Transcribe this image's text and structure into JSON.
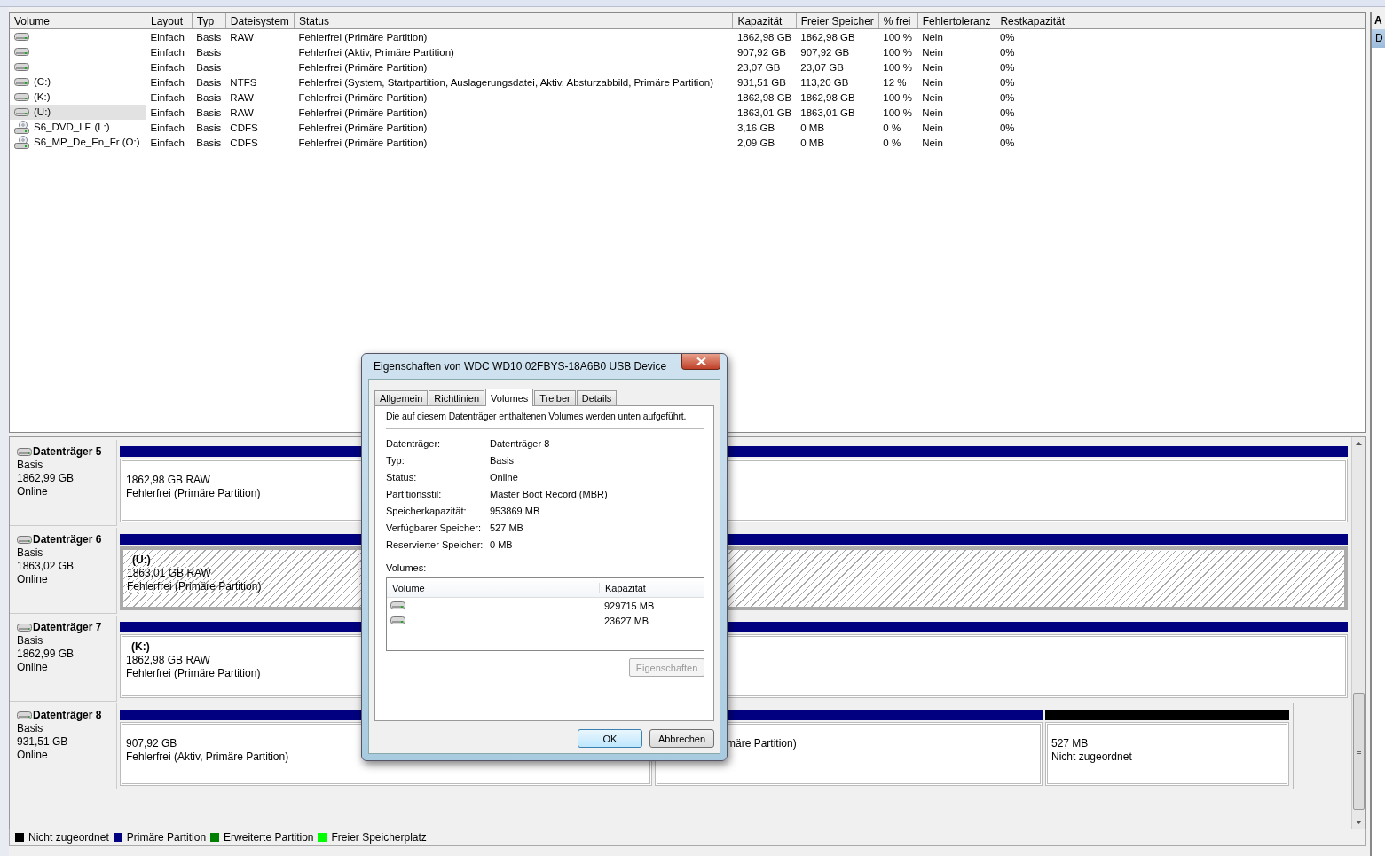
{
  "volumes_table": {
    "columns": [
      "Volume",
      "Layout",
      "Typ",
      "Dateisystem",
      "Status",
      "Kapazität",
      "Freier Speicher",
      "% frei",
      "Fehlertoleranz",
      "Restkapazität"
    ],
    "rows": [
      {
        "kind": "disk",
        "selected": false,
        "layout": "Einfach",
        "type": "Basis",
        "filesystem": "RAW",
        "status": "Fehlerfrei (Primäre Partition)",
        "capacity": "1862,98 GB",
        "free": "1862,98 GB",
        "percent_free": "100 %",
        "fault_tolerance": "Nein",
        "overhead": "0%"
      },
      {
        "kind": "disk",
        "selected": false,
        "layout": "Einfach",
        "type": "Basis",
        "status": "Fehlerfrei (Aktiv, Primäre Partition)",
        "capacity": "907,92 GB",
        "free": "907,92 GB",
        "percent_free": "100 %",
        "fault_tolerance": "Nein",
        "overhead": "0%"
      },
      {
        "kind": "disk",
        "selected": false,
        "layout": "Einfach",
        "type": "Basis",
        "status": "Fehlerfrei (Primäre Partition)",
        "capacity": "23,07 GB",
        "free": "23,07 GB",
        "percent_free": "100 %",
        "fault_tolerance": "Nein",
        "overhead": "0%"
      },
      {
        "kind": "disk",
        "selected": false,
        "volume": "(C:)",
        "layout": "Einfach",
        "type": "Basis",
        "filesystem": "NTFS",
        "status": "Fehlerfrei (System, Startpartition, Auslagerungsdatei, Aktiv, Absturzabbild, Primäre Partition)",
        "capacity": "931,51 GB",
        "free": "113,20 GB",
        "percent_free": "12 %",
        "fault_tolerance": "Nein",
        "overhead": "0%"
      },
      {
        "kind": "disk",
        "selected": false,
        "volume": "(K:)",
        "layout": "Einfach",
        "type": "Basis",
        "filesystem": "RAW",
        "status": "Fehlerfrei (Primäre Partition)",
        "capacity": "1862,98 GB",
        "free": "1862,98 GB",
        "percent_free": "100 %",
        "fault_tolerance": "Nein",
        "overhead": "0%"
      },
      {
        "kind": "disk",
        "selected": true,
        "volume": "(U:)",
        "layout": "Einfach",
        "type": "Basis",
        "filesystem": "RAW",
        "status": "Fehlerfrei (Primäre Partition)",
        "capacity": "1863,01 GB",
        "free": "1863,01 GB",
        "percent_free": "100 %",
        "fault_tolerance": "Nein",
        "overhead": "0%"
      },
      {
        "kind": "optical",
        "selected": false,
        "volume": "S6_DVD_LE (L:)",
        "layout": "Einfach",
        "type": "Basis",
        "filesystem": "CDFS",
        "status": "Fehlerfrei (Primäre Partition)",
        "capacity": "3,16 GB",
        "free": "0 MB",
        "percent_free": "0 %",
        "fault_tolerance": "Nein",
        "overhead": "0%"
      },
      {
        "kind": "optical",
        "selected": false,
        "volume": "S6_MP_De_En_Fr (O:)",
        "layout": "Einfach",
        "type": "Basis",
        "filesystem": "CDFS",
        "status": "Fehlerfrei (Primäre Partition)",
        "capacity": "2,09 GB",
        "free": "0 MB",
        "percent_free": "0 %",
        "fault_tolerance": "Nein",
        "overhead": "0%"
      }
    ]
  },
  "disks": [
    {
      "name": "Datenträger 5",
      "type": "Basis",
      "size": "1862,99 GB",
      "status": "Online",
      "partitions": [
        {
          "kind": "primary",
          "selected": false,
          "size_line": "1862,98 GB RAW",
          "status_line": "Fehlerfrei (Primäre Partition)"
        }
      ]
    },
    {
      "name": "Datenträger 6",
      "type": "Basis",
      "size": "1863,02 GB",
      "status": "Online",
      "partitions": [
        {
          "kind": "primary",
          "selected": true,
          "label": "(U:)",
          "size_line": "1863,01 GB RAW",
          "status_line": "Fehlerfrei (Primäre Partition)"
        }
      ]
    },
    {
      "name": "Datenträger 7",
      "type": "Basis",
      "size": "1862,99 GB",
      "status": "Online",
      "partitions": [
        {
          "kind": "primary",
          "selected": false,
          "label": "(K:)",
          "size_line": "1862,98 GB RAW",
          "status_line": "Fehlerfrei (Primäre Partition)"
        }
      ]
    },
    {
      "name": "Datenträger 8",
      "type": "Basis",
      "size": "931,51 GB",
      "status": "Online",
      "partitions": [
        {
          "kind": "primary",
          "selected": false,
          "size_line": "907,92 GB",
          "status_line": "Fehlerfrei (Aktiv, Primäre Partition)"
        },
        {
          "kind": "primary",
          "selected": false,
          "cut": true,
          "status_line": "märe Partition)"
        },
        {
          "kind": "unallocated",
          "selected": false,
          "size_line": "527 MB",
          "status_line": "Nicht zugeordnet"
        }
      ]
    }
  ],
  "legend": [
    {
      "label": "Nicht zugeordnet",
      "color": "#000000"
    },
    {
      "label": "Primäre Partition",
      "color": "#000080"
    },
    {
      "label": "Erweiterte Partition",
      "color": "#008000"
    },
    {
      "label": "Freier Speicherplatz",
      "color": "#00ff00"
    }
  ],
  "actions_pane": {
    "header": "A",
    "items": [
      {
        "label": "D",
        "selected": true
      }
    ]
  },
  "dialog": {
    "title": "Eigenschaften von WDC WD10 02FBYS-18A6B0 USB Device",
    "tabs": [
      {
        "label": "Allgemein",
        "selected": false
      },
      {
        "label": "Richtlinien",
        "selected": false
      },
      {
        "label": "Volumes",
        "selected": true
      },
      {
        "label": "Treiber",
        "selected": false
      },
      {
        "label": "Details",
        "selected": false
      }
    ],
    "intro": "Die auf diesem Datenträger enthaltenen Volumes werden unten aufgeführt.",
    "properties": [
      {
        "label": "Datenträger:",
        "value": "Datenträger 8"
      },
      {
        "label": "Typ:",
        "value": "Basis"
      },
      {
        "label": "Status:",
        "value": "Online"
      },
      {
        "label": "Partitionsstil:",
        "value": "Master Boot Record (MBR)"
      },
      {
        "label": "Speicherkapazität:",
        "value": "953869 MB"
      },
      {
        "label": "Verfügbarer Speicher:",
        "value": "527 MB"
      },
      {
        "label": "Reservierter Speicher:",
        "value": "0 MB"
      }
    ],
    "volumes_label": "Volumes:",
    "volumes_columns": [
      "Volume",
      "Kapazität"
    ],
    "volumes": [
      {
        "capacity": "929715 MB"
      },
      {
        "capacity": "23627 MB"
      }
    ],
    "properties_button": {
      "label": "Eigenschaften",
      "disabled": true
    },
    "buttons": [
      {
        "label": "OK",
        "default": true
      },
      {
        "label": "Abbrechen",
        "default": false
      }
    ]
  }
}
